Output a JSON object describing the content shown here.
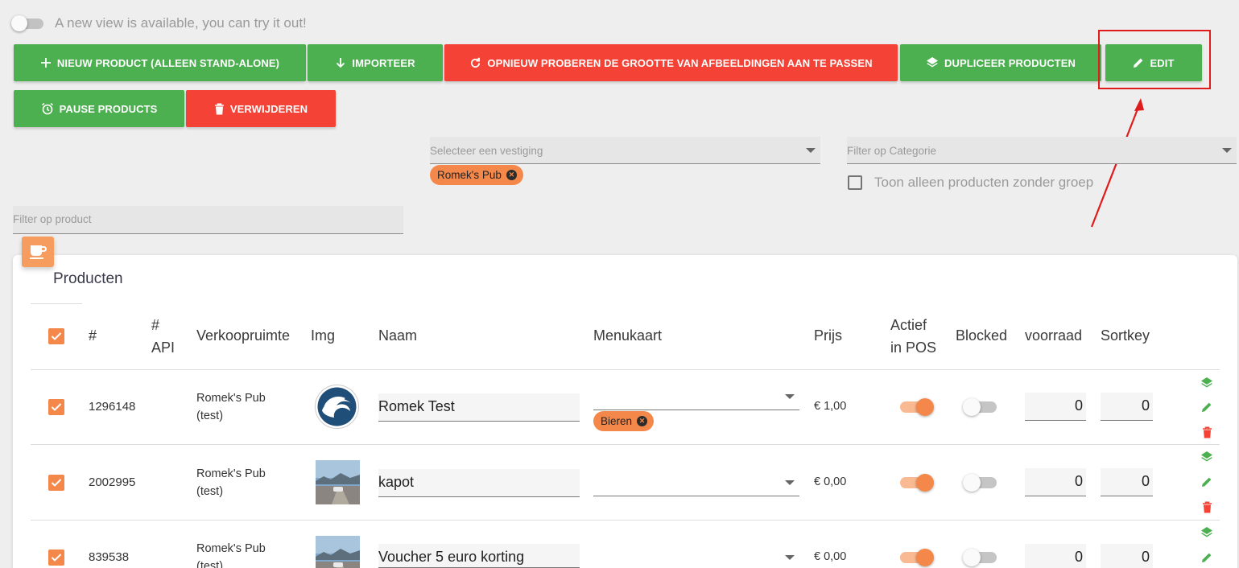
{
  "notice": {
    "text": "A new view is available, you can try it out!"
  },
  "toolbar": {
    "new_product": "NIEUW PRODUCT (ALLEEN STAND-ALONE)",
    "import": "IMPORTEER",
    "retry_resize": "OPNIEUW PROBEREN DE GROOTTE VAN AFBEELDINGEN AAN TE PASSEN",
    "duplicate": "DUPLICEER PRODUCTEN",
    "edit": "EDIT",
    "pause": "PAUSE PRODUCTS",
    "delete": "VERWIJDEREN"
  },
  "filters": {
    "location_placeholder": "Selecteer een vestiging",
    "location_chip": "Romek's Pub",
    "category_placeholder": "Filter op Categorie",
    "no_group_label": "Toon alleen producten zonder groep",
    "product_placeholder": "Filter op product"
  },
  "card": {
    "title": "Producten"
  },
  "table": {
    "headers": {
      "id": "#",
      "api_1": "#",
      "api_2": "API",
      "location": "Verkoopruimte",
      "img": "Img",
      "name": "Naam",
      "menu": "Menukaart",
      "price": "Prijs",
      "active_1": "Actief",
      "active_2": "in POS",
      "blocked": "Blocked",
      "stock": "voorraad",
      "sortkey": "Sortkey"
    },
    "rows": [
      {
        "id": "1296148",
        "loc1": "Romek's Pub",
        "loc2": "(test)",
        "name": "Romek Test",
        "menu_chip": "Bieren",
        "price": "€ 1,00",
        "active": true,
        "blocked": false,
        "stock": "0",
        "sortkey": "0",
        "img": "logo"
      },
      {
        "id": "2002995",
        "loc1": "Romek's Pub",
        "loc2": "(test)",
        "name": "kapot",
        "menu_chip": "",
        "price": "€ 0,00",
        "active": true,
        "blocked": false,
        "stock": "0",
        "sortkey": "0",
        "img": "photo"
      },
      {
        "id": "839538",
        "loc1": "Romek's Pub",
        "loc2": "(test)",
        "name": "Voucher 5 euro korting",
        "menu_chip": "",
        "price": "€ 0,00",
        "active": true,
        "blocked": false,
        "stock": "0",
        "sortkey": "0",
        "img": "photo"
      }
    ]
  },
  "colors": {
    "green": "#4caf50",
    "red": "#f44336",
    "orange": "#f4884a",
    "highlight": "#e01b1b"
  }
}
